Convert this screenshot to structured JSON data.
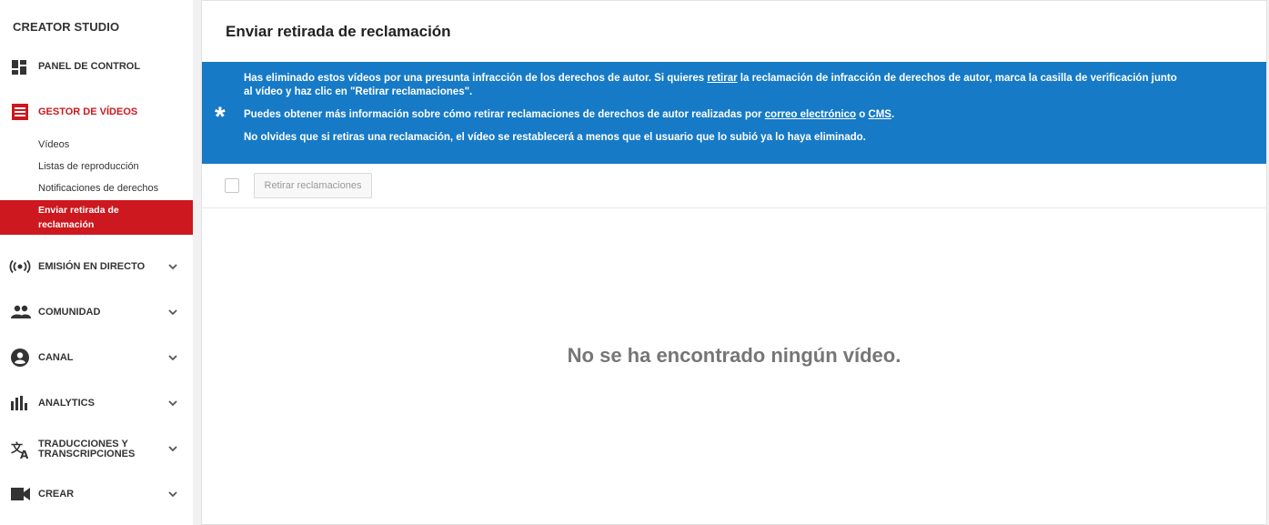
{
  "sidebar": {
    "brand": "CREATOR STUDIO",
    "dashboard": "PANEL DE CONTROL",
    "video_manager": "GESTOR DE VÍDEOS",
    "sub_items": [
      "Vídeos",
      "Listas de reproducción",
      "Notificaciones de derechos"
    ],
    "active_sub": "Enviar retirada de reclamación",
    "live": "EMISIÓN EN DIRECTO",
    "community": "COMUNIDAD",
    "channel": "CANAL",
    "analytics": "ANALYTICS",
    "translations_1": "TRADUCCIONES Y",
    "translations_2": "TRANSCRIPCIONES",
    "create": "CREAR",
    "accent_color": "#cc181e"
  },
  "main": {
    "title": "Enviar retirada de reclamación",
    "banner": {
      "color": "#167ac6",
      "line1_a": "Has eliminado estos vídeos por una presunta infracción de los derechos de autor. Si quieres ",
      "line1_link": "retirar",
      "line1_b": " la reclamación de infracción de derechos de autor, marca la casilla de verificación junto",
      "line2": "al vídeo y haz clic en \"Retirar reclamaciones\".",
      "line3_a": "Puedes obtener más información sobre cómo retirar reclamaciones de derechos de autor realizadas por ",
      "line3_link1": "correo electrónico",
      "line3_b": " o ",
      "line3_link2": "CMS",
      "line3_c": ".",
      "line4": "No olvides que si retiras una reclamación, el vídeo se restablecerá a menos que el usuario que lo subió ya lo haya eliminado.",
      "asterisk": "*"
    },
    "retract_button": "Retirar reclamaciones",
    "empty_message": "No se ha encontrado ningún vídeo."
  }
}
